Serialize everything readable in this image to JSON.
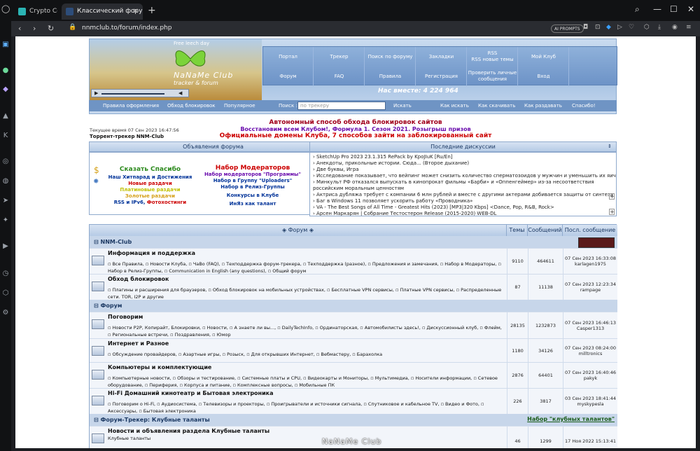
{
  "browser": {
    "tabs": [
      {
        "label": "Crypto Corne"
      },
      {
        "label": "Классический форум-тр"
      }
    ],
    "url": "nnmclub.to/forum/index.php",
    "ai_prompts": "AI PROMPTS"
  },
  "header": {
    "leech": "Free leech day",
    "brand": "NaNaMe Club",
    "tagline": "tracker & forum",
    "menu": [
      "Портал",
      "Трекер",
      "Поиск по форуму",
      "Закладки",
      "RSS\nRSS новые темы",
      "Мой Клуб",
      "Форум",
      "FAQ",
      "Правила",
      "Регистрация",
      "Проверить личные сообщения",
      "Вход"
    ],
    "together": "Нас вместе: 4 224 964",
    "bar_links": [
      "Правила оформления",
      "Обход блокировок",
      "Популярное",
      "Поиск :",
      "Искать",
      "Как искать",
      "Как скачивать",
      "Как раздавать",
      "Спасибо!"
    ],
    "search_placeholder": "по трекеру"
  },
  "notice": {
    "title": "Автономный способ обхода блокировок сайтов",
    "line2a": "Восстановим всем Клубом!,",
    "line2b": "Формула 1. Сезон 2021. Розыгрыш призов",
    "line3a": "Официальные домены Клуба,",
    "line3b": "7 способов зайти на заблокированный сайт",
    "time": "Текущее время 07 Сен 2023 16:47:56",
    "tracker": "Торрент-трекер NNM-Club"
  },
  "announcements": {
    "title": "Объявления форума",
    "left": [
      "Сказать Спасибо",
      "Наш Хитпарад и Достижения",
      "Новые раздачи",
      "Платиновые раздачи",
      "Золотые раздачи"
    ],
    "rss": "RSS и IPv6,",
    "photo": "Фотохостинги",
    "right": [
      "Набор Модераторов",
      "Набор модераторов \"Программы\"",
      "Набор в Группу \"Uploaders\"",
      "Набор в Релиз-Группы",
      "Конкурсы в Клубе",
      "ИнЯз как талант"
    ]
  },
  "discussions": {
    "title": "Последние дискуссии",
    "items": [
      "SketchUp Pro 2023 23.1.315 RePack by KpoJIuK [Ru/En]",
      "Анекдоты, прикольные истории. Сюда... (Второе дыхание)",
      "Две буквы, Игра",
      "Исследование показывает, что вейпинг может снизить количество сперматозоидов у мужчин и уменьшить их яички",
      "Минкульт РФ отказался выпускать в кинопрокат фильмы «Барби» и «Оппенгеймер» из-за несоответствия российским моральным ценностям",
      "Актриса дубляжа требует с компании 6 млн рублей и вместе с другими актерами добивается защиты от синтеза",
      "Баг в Windows 11 позволяет ускорить работу «Проводника»",
      "VA - The Best Songs of All Time - Greatest Hits (2023) [MP3|320 Kbps] <Dance, Pop, R&B, Rock>",
      "Арсен Маркарян | Собрание Тестостерон Release (2015-2020) WEB-DL"
    ]
  },
  "forum": {
    "cols": [
      "Форум",
      "Темы",
      "Сообщений",
      "Посл. сообщение"
    ],
    "categories": [
      "NNM-Club",
      "Форум",
      "Форум-Трекер: Клубные таланты"
    ],
    "talent_link": "Набор \"клубных талантов\"",
    "rows": [
      {
        "name": "Информация и поддержка",
        "sub": "▫ Все Правила, ▫ Новости Клуба, ▫ ЧаВо (FAQ), ▫ Техподдержка форум-трекера, ▫ Техподдержка (разное), ▫ Предложения и замечания, ▫ Набор в Модераторы, ▫ Набор в Релиз-Группы, ▫ Communication in English (any questions), ▫ Общий форум",
        "topics": "9110",
        "posts": "464611",
        "date": "07 Сен 2023 16:33:08",
        "user": "karlagen1975"
      },
      {
        "name": "Обход блокировок",
        "sub": "▫ Плагины и расширения для браузеров, ▫ Обход блокировок на мобильных устройствах, ▫ Бесплатные VPN сервисы, ▫ Платные VPN сервисы, ▫ Распределенные сети. TOR, I2P и другие",
        "topics": "87",
        "posts": "11138",
        "date": "07 Сен 2023 12:23:34",
        "user": "rampage"
      },
      {
        "name": "Поговорим",
        "sub": "▫ Новости P2P, Копирайт, Блокировки, ▫ Новости, ▫ А знаете ли вы..., ▫ DailyTechInfo, ▫ Ординаторская, ▫ Автомобилисты здесь!, ▫ Дискуссионный клуб, ▫ Флейм, ▫ Региональные встречи, ▫ Поздравления, ▫ Юмор",
        "topics": "28135",
        "posts": "1232873",
        "date": "07 Сен 2023 16:46:13",
        "user": "Casper1313"
      },
      {
        "name": "Интернет и Разное",
        "sub": "▫ Обсуждение провайдеров, ▫ Азартные игры, ▫ Розыск, ▫ Для открывших Интернет, ▫ Вебмастеру, ▫ Барахолка",
        "topics": "1180",
        "posts": "34126",
        "date": "07 Сен 2023 08:24:00",
        "user": "milltronics"
      },
      {
        "name": "Компьютеры и комплектующие",
        "sub": "▫ Компьютерные новости, ▫ Обзоры и тестирование, ▫ Системные платы и CPU, ▫ Видеокарты и Мониторы, ▫ Мультимедиа, ▫ Носители информации, ▫ Сетевое оборудование, ▫ Периферия, ▫ Корпуса и питание, ▫ Комплексные вопросы, ▫ Мобильные ПК",
        "topics": "2876",
        "posts": "64401",
        "date": "07 Сен 2023 16:40:46",
        "user": "pakyk"
      },
      {
        "name": "Hi-Fi Домашний кинотеатр и Бытовая электроника",
        "sub": "▫ Поговорим о Hi-Fi, ▫ Аудиосистема, ▫ Телевизоры и проекторы, ▫ Проигрыватели и источники сигнала, ▫ Спутниковое и кабельное TV, ▫ Видео и Фото, ▫ Аксессуары, ▫ Бытовая электроника",
        "topics": "226",
        "posts": "3817",
        "date": "03 Сен 2023 18:41:44",
        "user": "myskypesla"
      },
      {
        "name": "Новости и объявления раздела Клубные таланты",
        "sub": "Клубные таланты",
        "topics": "46",
        "posts": "1299",
        "date": "17 Ноя 2022 15:13:41",
        "user": ""
      }
    ]
  },
  "footer_logo": "NaNaMe Club"
}
